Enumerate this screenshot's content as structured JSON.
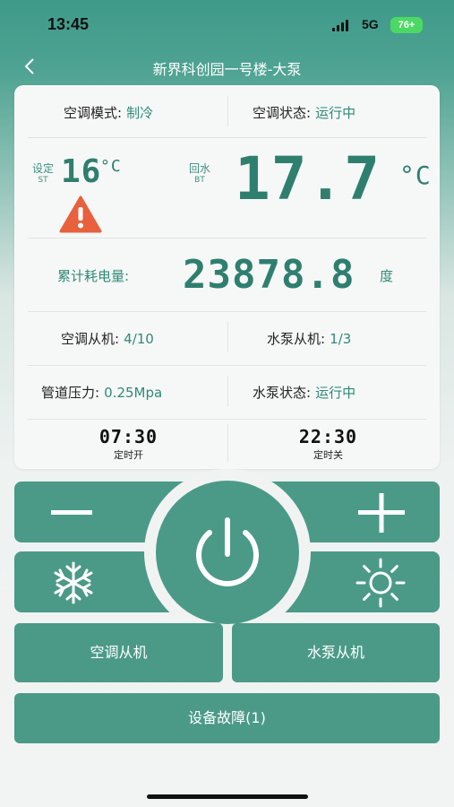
{
  "status": {
    "time": "13:45",
    "network": "5G",
    "battery": "76+"
  },
  "nav": {
    "title": "新界科创园一号楼-大泵"
  },
  "mode": {
    "label": "空调模式:",
    "value": "制冷"
  },
  "ac_status": {
    "label": "空调状态:",
    "value": "运行中"
  },
  "setpoint": {
    "label": "设定",
    "sub": "ST",
    "value": "16",
    "unit": "°C"
  },
  "return_water": {
    "label": "回水",
    "sub": "BT",
    "value": "17.7",
    "unit": "°C"
  },
  "energy": {
    "label": "累计耗电量:",
    "value": "23878.8",
    "unit": "度"
  },
  "ac_slave": {
    "label": "空调从机:",
    "value": "4/10"
  },
  "pump_slave": {
    "label": "水泵从机:",
    "value": "1/3"
  },
  "pressure": {
    "label": "管道压力:",
    "value": "0.25Mpa"
  },
  "pump_status": {
    "label": "水泵状态:",
    "value": "运行中"
  },
  "timer_on": {
    "time": "07:30",
    "label": "定时开"
  },
  "timer_off": {
    "time": "22:30",
    "label": "定时关"
  },
  "buttons": {
    "ac_slave": "空调从机",
    "pump_slave": "水泵从机",
    "fault": "设备故障(1)"
  },
  "icons": {
    "warning": "warning-icon",
    "power": "power-icon",
    "cool": "snowflake-icon",
    "heat": "sun-icon",
    "minus": "minus-icon",
    "plus": "plus-icon"
  },
  "colors": {
    "accent": "#4b9a88",
    "value_text": "#2f8a78",
    "warning": "#e8603c"
  }
}
